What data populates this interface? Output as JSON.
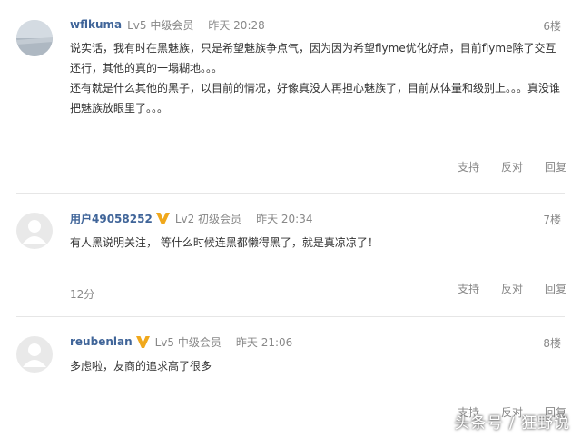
{
  "comments": [
    {
      "username": "wflkuma",
      "level": "Lv5 中级会员",
      "time": "昨天 20:28",
      "floor": "6楼",
      "paragraphs": [
        "说实话，我有时在黑魅族，只是希望魅族争点气，因为因为希望flyme优化好点，目前flyme除了交互还行，其他的真的一塌糊地。。。",
        "还有就是什么其他的黑子，以目前的情况，好像真没人再担心魅族了，目前从体量和级别上。。。真没谁把魅族放眼里了。。。"
      ],
      "actions": [
        "支持",
        "反对",
        "回复"
      ]
    },
    {
      "username": "用户49058252",
      "level": "Lv2 初级会员",
      "time": "昨天 20:34",
      "floor": "7楼",
      "paragraphs": [
        "有人黑说明关注， 等什么时候连黑都懒得黑了，就是真凉凉了！"
      ],
      "score": "12分",
      "actions": [
        "支持",
        "反对",
        "回复"
      ]
    },
    {
      "username": "reubenlan",
      "level": "Lv5 中级会员",
      "time": "昨天 21:06",
      "floor": "8楼",
      "paragraphs": [
        "多虑啦，友商的追求高了很多"
      ],
      "actions": [
        "支持",
        "反对",
        "回复"
      ]
    }
  ],
  "watermark": "头条号 / 狂野说",
  "colors": {
    "username": "#406599",
    "meta": "#888888",
    "vip_badge": "#f0a81c"
  }
}
